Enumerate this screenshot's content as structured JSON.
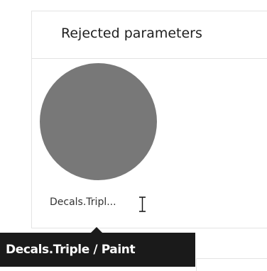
{
  "panel": {
    "title": "Rejected parameters",
    "items": [
      {
        "caption": "Decals.Tripl...",
        "thumb_color": "#787878"
      }
    ]
  },
  "tooltip": {
    "text": "Decals.Triple / Paint"
  },
  "cursor": {
    "type": "text-cursor-icon"
  }
}
